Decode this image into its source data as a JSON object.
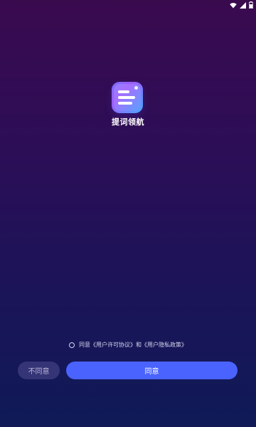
{
  "status_bar": {
    "icons": [
      "wifi-icon",
      "signal-icon",
      "battery-icon"
    ]
  },
  "app": {
    "name": "提词领航",
    "icon": "teleprompter-app-icon"
  },
  "agreement": {
    "prefix": "同意",
    "user_agreement_link": "《用户许可协议》",
    "conjunction": "和",
    "privacy_policy_link": "《用户隐私政策》",
    "checked": false
  },
  "buttons": {
    "decline_label": "不同意",
    "agree_label": "同意"
  },
  "colors": {
    "background_top": "#3a0a4f",
    "background_bottom": "#0f1a57",
    "agree_button": "#4a63ff",
    "decline_button": "#4e4880"
  }
}
